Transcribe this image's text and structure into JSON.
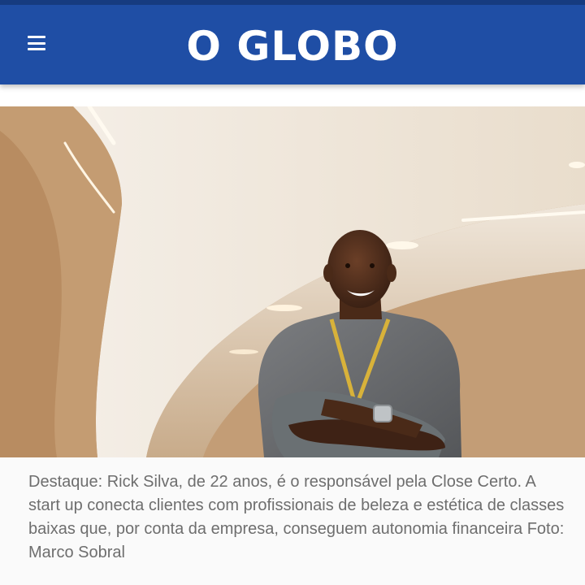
{
  "header": {
    "logo_text": "O GLOBO",
    "menu_icon": "hamburger-menu-icon",
    "background_color": "#1f4ea5"
  },
  "article": {
    "photo_icon": "photo-person-portrait",
    "caption": "Destaque: Rick Silva, de 22 anos, é o responsável pela Close Certo. A start up conecta clientes com profissionais de beleza e estética de classes baixas que, por conta da empresa, conseguem autonomia financeira Foto: Marco Sobral"
  }
}
